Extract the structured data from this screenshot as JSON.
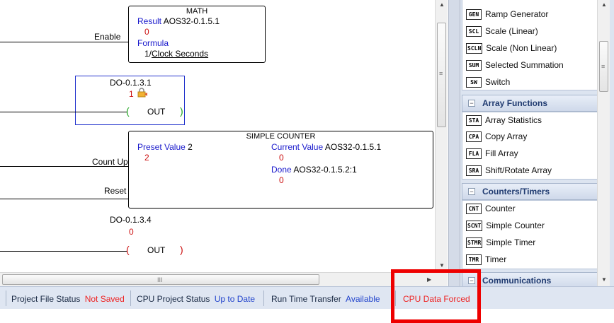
{
  "math_block": {
    "title": "MATH",
    "enable_label": "Enable",
    "result_label": "Result",
    "result_address": "AOS32-0.1.5.1",
    "result_value": "0",
    "formula_label": "Formula",
    "formula_prefix": "1/",
    "formula_link": "Clock Seconds"
  },
  "do1": {
    "address": "DO-0.1.3.1",
    "value": "1",
    "open": "(",
    "label": "OUT",
    "close": ")"
  },
  "counter_block": {
    "title": "SIMPLE COUNTER",
    "count_up_label": "Count Up",
    "reset_label": "Reset",
    "preset_label": "Preset Value",
    "preset_value": "2",
    "preset_current": "2",
    "current_label": "Current Value",
    "current_address": "AOS32-0.1.5.1",
    "current_value": "0",
    "done_label": "Done",
    "done_address": "AOS32-0.1.5.2:1",
    "done_value": "0"
  },
  "do4": {
    "address": "DO-0.1.3.4",
    "value": "0",
    "open": "(",
    "label": "OUT",
    "close": ")"
  },
  "scroll": {
    "hscroll_grip": "III",
    "vscroll_grip": "≡",
    "panel_grip": "≡"
  },
  "panel": {
    "top_items": [
      {
        "tag": "GEN",
        "label": "Ramp Generator"
      },
      {
        "tag": "SCL",
        "label": "Scale (Linear)"
      },
      {
        "tag": "SCLN",
        "label": "Scale (Non Linear)"
      },
      {
        "tag": "SUM",
        "label": "Selected Summation"
      },
      {
        "tag": "SW",
        "label": "Switch"
      }
    ],
    "array_group": {
      "title": "Array Functions",
      "items": [
        {
          "tag": "STA",
          "label": "Array Statistics"
        },
        {
          "tag": "CPA",
          "label": "Copy Array"
        },
        {
          "tag": "FLA",
          "label": "Fill Array"
        },
        {
          "tag": "SRA",
          "label": "Shift/Rotate Array"
        }
      ]
    },
    "counters_group": {
      "title": "Counters/Timers",
      "items": [
        {
          "tag": "CNT",
          "label": "Counter"
        },
        {
          "tag": "SCNT",
          "label": "Simple Counter"
        },
        {
          "tag": "STMR",
          "label": "Simple Timer"
        },
        {
          "tag": "TMR",
          "label": "Timer"
        }
      ]
    },
    "comm_group": {
      "title": "Communications"
    }
  },
  "status": {
    "project_file_label": "Project File Status",
    "project_file_value": "Not Saved",
    "cpu_project_label": "CPU Project Status",
    "cpu_project_value": "Up to Date",
    "runtime_label": "Run Time Transfer",
    "runtime_value": "Available",
    "cpu_forced": "CPU Data Forced"
  },
  "colors": {
    "blue_text": "#1a1acc",
    "red_text": "#cc1111",
    "highlight": "#ee0000"
  }
}
